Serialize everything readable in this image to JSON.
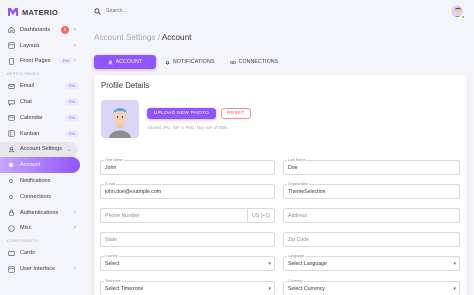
{
  "app": {
    "name": "MATERIO",
    "brand_color": "#9155fd"
  },
  "sidebar": {
    "dashboards": {
      "label": "Dashboards",
      "badge": "5"
    },
    "layouts": {
      "label": "Layouts"
    },
    "front_pages": {
      "label": "Front Pages",
      "pro": "Pro"
    },
    "apps_section": "APPS & PAGES",
    "email": {
      "label": "Email",
      "pro": "Pro"
    },
    "chat": {
      "label": "Chat",
      "pro": "Pro"
    },
    "calendar": {
      "label": "Calendar",
      "pro": "Pro"
    },
    "kanban": {
      "label": "Kanban",
      "pro": "Pro"
    },
    "account_settings": {
      "label": "Account Settings"
    },
    "account": {
      "label": "Account"
    },
    "notifications": {
      "label": "Notifications"
    },
    "connections": {
      "label": "Connections"
    },
    "authentications": {
      "label": "Authentications"
    },
    "misc": {
      "label": "Misc"
    },
    "components_section": "COMPONENTS",
    "cards": {
      "label": "Cards"
    },
    "user_interface": {
      "label": "User Interface"
    }
  },
  "topbar": {
    "search_placeholder": "Search..."
  },
  "breadcrumb": {
    "parent": "Account Settings",
    "separator": " / ",
    "current": "Account"
  },
  "tabs": {
    "account": "ACCOUNT",
    "notifications": "NOTIFICATIONS",
    "connections": "CONNECTIONS"
  },
  "profile": {
    "title": "Profile Details",
    "upload_label": "UPLOAD NEW PHOTO",
    "reset_label": "RESET",
    "hint": "Allowed JPG, GIF or PNG. Max size of 800K"
  },
  "form": {
    "first_name": {
      "label": "First Name",
      "value": "John"
    },
    "last_name": {
      "label": "Last Name",
      "value": "Doe"
    },
    "email": {
      "label": "E-mail",
      "value": "john.doe@example.com"
    },
    "organization": {
      "label": "Organization",
      "value": "ThemeSelection"
    },
    "phone": {
      "placeholder": "Phone Number",
      "suffix": "US (+1)"
    },
    "address": {
      "placeholder": "Address"
    },
    "state": {
      "placeholder": "State"
    },
    "zip": {
      "placeholder": "Zip Code"
    },
    "country": {
      "label": "Country",
      "value": "Select"
    },
    "language": {
      "label": "Language",
      "value": "Select Language"
    },
    "timezone": {
      "label": "Timezone",
      "value": "Select Timezone"
    },
    "currency": {
      "label": "Currency",
      "value": "Select Currency"
    }
  }
}
